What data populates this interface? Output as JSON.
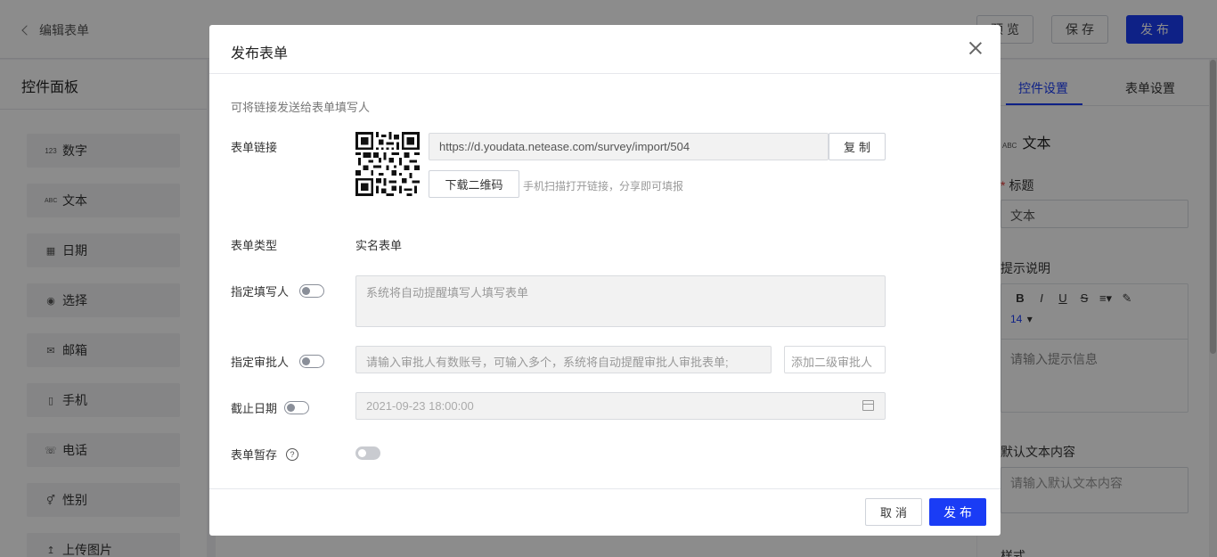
{
  "topbar": {
    "back_label": "编辑表单",
    "preview_label": "预览",
    "save_label": "保存",
    "publish_label": "发布"
  },
  "left_panel": {
    "title": "控件面板",
    "items": [
      {
        "icon": "123",
        "label": "数字"
      },
      {
        "icon": "ABC",
        "label": "文本"
      },
      {
        "icon": "calendar-icon",
        "label": "日期"
      },
      {
        "icon": "radio-icon",
        "label": "选择"
      },
      {
        "icon": "mail-icon",
        "label": "邮箱"
      },
      {
        "icon": "phone-icon",
        "label": "手机"
      },
      {
        "icon": "telephone-icon",
        "label": "电话"
      },
      {
        "icon": "gender-icon",
        "label": "性别"
      },
      {
        "icon": "upload-icon",
        "label": "上传图片"
      }
    ]
  },
  "right_panel": {
    "tabs": [
      "控件设置",
      "表单设置"
    ],
    "control_type_badge": "ABC",
    "control_type": "文本",
    "title_label": "标题",
    "title_value": "文本",
    "hint_label": "提示说明",
    "font_size": "14",
    "hint_placeholder": "请输入提示信息",
    "default_label": "默认文本内容",
    "default_placeholder": "请输入默认文本内容",
    "style_label": "样式"
  },
  "modal": {
    "title": "发布表单",
    "hint": "可将链接发送给表单填写人",
    "link_label": "表单链接",
    "link_url": "https://d.youdata.netease.com/survey/import/504",
    "copy_label": "复制",
    "download_qr_label": "下载二维码",
    "qr_hint": "手机扫描打开链接，分享即可填报",
    "type_label": "表单类型",
    "type_value": "实名表单",
    "assign_filler_label": "指定填写人",
    "assign_filler_placeholder": "系统将自动提醒填写人填写表单",
    "assign_approver_label": "指定审批人",
    "approver_placeholder": "请输入审批人有数账号，可输入多个，系统将自动提醒审批人审批表单;",
    "second_approver_placeholder": "添加二级审批人",
    "deadline_label": "截止日期",
    "deadline_value": "2021-09-23 18:00:00",
    "draft_label": "表单暂存",
    "cancel_label": "取消",
    "publish_label": "发布"
  }
}
